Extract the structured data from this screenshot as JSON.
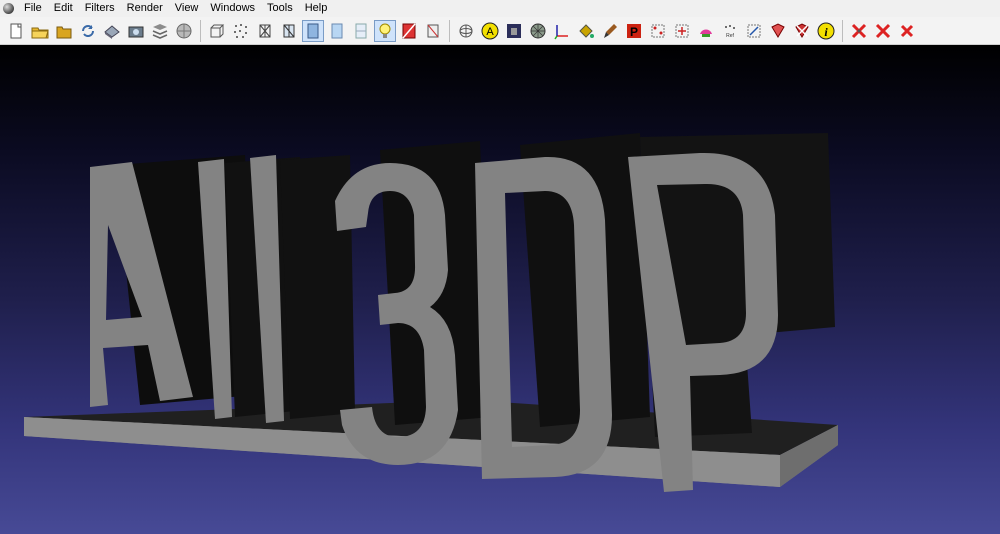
{
  "menu": {
    "items": [
      {
        "id": "file",
        "label": "File"
      },
      {
        "id": "edit",
        "label": "Edit"
      },
      {
        "id": "filters",
        "label": "Filters"
      },
      {
        "id": "render",
        "label": "Render"
      },
      {
        "id": "view",
        "label": "View"
      },
      {
        "id": "windows",
        "label": "Windows"
      },
      {
        "id": "tools",
        "label": "Tools"
      },
      {
        "id": "help",
        "label": "Help"
      }
    ]
  },
  "toolbar": {
    "groups": [
      [
        {
          "icon": "new-project-icon"
        },
        {
          "icon": "open-project-icon"
        },
        {
          "icon": "open-folder-icon"
        },
        {
          "icon": "reload-icon"
        },
        {
          "icon": "save-snapshot-icon"
        },
        {
          "icon": "camera-icon"
        },
        {
          "icon": "layers-icon"
        },
        {
          "icon": "sphere-icon"
        }
      ],
      [
        {
          "icon": "bounding-box-icon"
        },
        {
          "icon": "points-icon"
        },
        {
          "icon": "wireframe-icon"
        },
        {
          "icon": "hidden-lines-icon"
        },
        {
          "icon": "flat-shading-icon",
          "active": true
        },
        {
          "icon": "smooth-shading-icon"
        },
        {
          "icon": "texture-icon"
        },
        {
          "icon": "light-bulb-icon",
          "active": true
        },
        {
          "icon": "backface-icon"
        },
        {
          "icon": "double-side-icon"
        }
      ],
      [
        {
          "icon": "trackball-icon"
        },
        {
          "icon": "annotation-a-icon"
        },
        {
          "icon": "raster-layer-icon"
        },
        {
          "icon": "mesh-sphere-icon"
        },
        {
          "icon": "axes-icon"
        },
        {
          "icon": "paint-bucket-icon"
        },
        {
          "icon": "paint-brush-icon"
        },
        {
          "icon": "pick-points-icon"
        },
        {
          "icon": "select-vertices-icon"
        },
        {
          "icon": "move-selection-icon"
        },
        {
          "icon": "color-paint-icon"
        },
        {
          "icon": "reference-icon"
        },
        {
          "icon": "align-icon"
        },
        {
          "icon": "select-faces-icon"
        },
        {
          "icon": "delete-faces-icon"
        },
        {
          "icon": "info-icon"
        }
      ],
      [
        {
          "icon": "delete-vertices-icon"
        },
        {
          "icon": "delete-selected-icon"
        },
        {
          "icon": "close-icon"
        }
      ]
    ]
  },
  "colors": {
    "menubar_bg": "#f0f0f0",
    "toolbar_bg": "#f3f3f3",
    "viewport_top": "#000000",
    "viewport_bottom": "#474a96",
    "model_front": "#838383",
    "model_side": "#161616"
  },
  "viewport": {
    "model_text": "All3DP"
  }
}
